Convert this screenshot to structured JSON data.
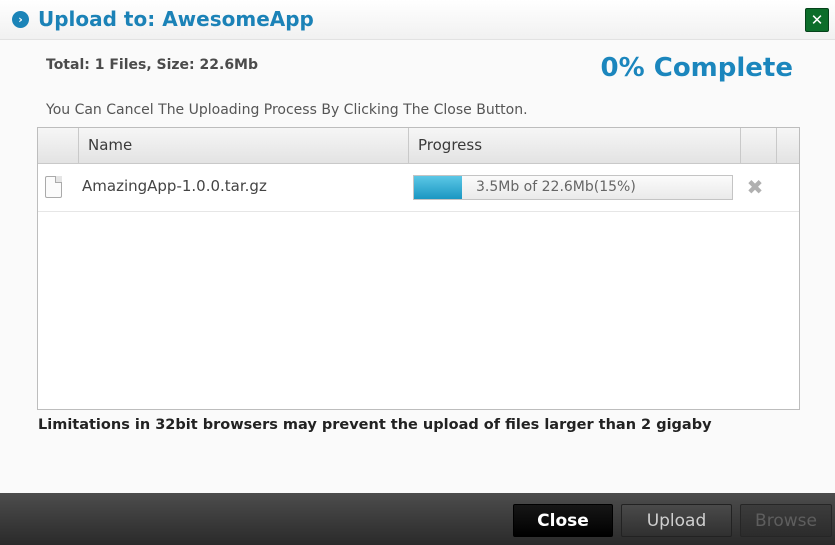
{
  "dialog": {
    "title": "Upload to: AwesomeApp",
    "title_icon": "arrow-circle-icon",
    "close_icon": "close-x-icon",
    "total": "Total: 1 Files, Size: 22.6Mb",
    "complete": "0% Complete",
    "cancel_info": "You Can Cancel The Uploading Process By Clicking The Close Button.",
    "limitation": "Limitations in 32bit browsers may prevent the upload of files larger than 2 gigaby"
  },
  "table": {
    "columns": [
      "",
      "Name",
      "Progress",
      "",
      ""
    ],
    "rows": [
      {
        "icon": "file-icon",
        "name": "AmazingApp-1.0.0.tar.gz",
        "progress_text": "3.5Mb of 22.6Mb(15%)",
        "progress_fraction": 0.15,
        "action_icon": "remove-x-icon"
      }
    ]
  },
  "footer": {
    "close_label": "Close",
    "upload_label": "Upload",
    "browse_label": "Browse"
  },
  "colors": {
    "accent": "#1b82b7",
    "progress": "#1a97c2",
    "close_button": "#0c6d2a"
  }
}
